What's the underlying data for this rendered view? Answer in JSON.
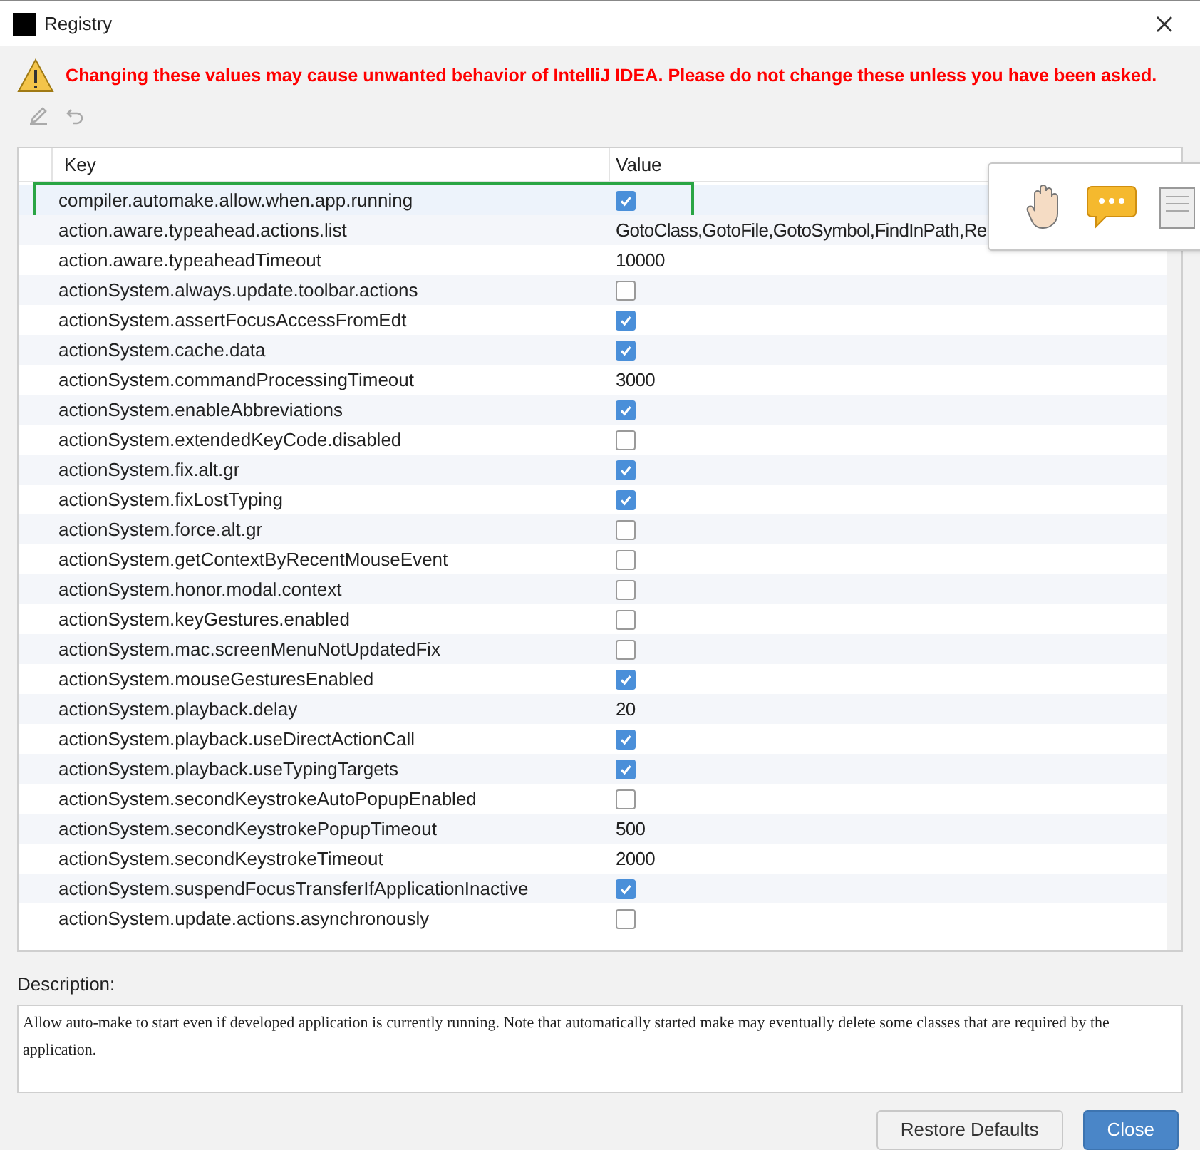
{
  "window": {
    "title": "Registry"
  },
  "warning": "Changing these values may cause unwanted behavior of IntelliJ IDEA. Please do not change these unless you have been asked.",
  "table": {
    "columns": [
      "Key",
      "Value"
    ],
    "rows": [
      {
        "key": "compiler.automake.allow.when.app.running",
        "kind": "checkbox",
        "checked": true,
        "selected": true
      },
      {
        "key": "action.aware.typeahead.actions.list",
        "kind": "text",
        "value": "GotoClass,GotoFile,GotoSymbol,FindInPath,Re",
        "selected": false
      },
      {
        "key": "action.aware.typeaheadTimeout",
        "kind": "text",
        "value": "10000",
        "selected": false
      },
      {
        "key": "actionSystem.always.update.toolbar.actions",
        "kind": "checkbox",
        "checked": false,
        "selected": false
      },
      {
        "key": "actionSystem.assertFocusAccessFromEdt",
        "kind": "checkbox",
        "checked": true,
        "selected": false
      },
      {
        "key": "actionSystem.cache.data",
        "kind": "checkbox",
        "checked": true,
        "selected": false
      },
      {
        "key": "actionSystem.commandProcessingTimeout",
        "kind": "text",
        "value": "3000",
        "selected": false
      },
      {
        "key": "actionSystem.enableAbbreviations",
        "kind": "checkbox",
        "checked": true,
        "selected": false
      },
      {
        "key": "actionSystem.extendedKeyCode.disabled",
        "kind": "checkbox",
        "checked": false,
        "selected": false
      },
      {
        "key": "actionSystem.fix.alt.gr",
        "kind": "checkbox",
        "checked": true,
        "selected": false
      },
      {
        "key": "actionSystem.fixLostTyping",
        "kind": "checkbox",
        "checked": true,
        "selected": false
      },
      {
        "key": "actionSystem.force.alt.gr",
        "kind": "checkbox",
        "checked": false,
        "selected": false
      },
      {
        "key": "actionSystem.getContextByRecentMouseEvent",
        "kind": "checkbox",
        "checked": false,
        "selected": false
      },
      {
        "key": "actionSystem.honor.modal.context",
        "kind": "checkbox",
        "checked": false,
        "selected": false
      },
      {
        "key": "actionSystem.keyGestures.enabled",
        "kind": "checkbox",
        "checked": false,
        "selected": false
      },
      {
        "key": "actionSystem.mac.screenMenuNotUpdatedFix",
        "kind": "checkbox",
        "checked": false,
        "selected": false
      },
      {
        "key": "actionSystem.mouseGesturesEnabled",
        "kind": "checkbox",
        "checked": true,
        "selected": false
      },
      {
        "key": "actionSystem.playback.delay",
        "kind": "text",
        "value": "20",
        "selected": false
      },
      {
        "key": "actionSystem.playback.useDirectActionCall",
        "kind": "checkbox",
        "checked": true,
        "selected": false
      },
      {
        "key": "actionSystem.playback.useTypingTargets",
        "kind": "checkbox",
        "checked": true,
        "selected": false
      },
      {
        "key": "actionSystem.secondKeystrokeAutoPopupEnabled",
        "kind": "checkbox",
        "checked": false,
        "selected": false
      },
      {
        "key": "actionSystem.secondKeystrokePopupTimeout",
        "kind": "text",
        "value": "500",
        "selected": false
      },
      {
        "key": "actionSystem.secondKeystrokeTimeout",
        "kind": "text",
        "value": "2000",
        "selected": false
      },
      {
        "key": "actionSystem.suspendFocusTransferIfApplicationInactive",
        "kind": "checkbox",
        "checked": true,
        "selected": false
      },
      {
        "key": "actionSystem.update.actions.asynchronously",
        "kind": "checkbox",
        "checked": false,
        "selected": false
      }
    ]
  },
  "description": {
    "label": "Description:",
    "text": "Allow auto-make to start even if developed application is currently running. Note that automatically started make may eventually delete some classes that are required by the application."
  },
  "buttons": [
    {
      "label": "Restore Defaults",
      "primary": false
    },
    {
      "label": "Close",
      "primary": true
    }
  ]
}
